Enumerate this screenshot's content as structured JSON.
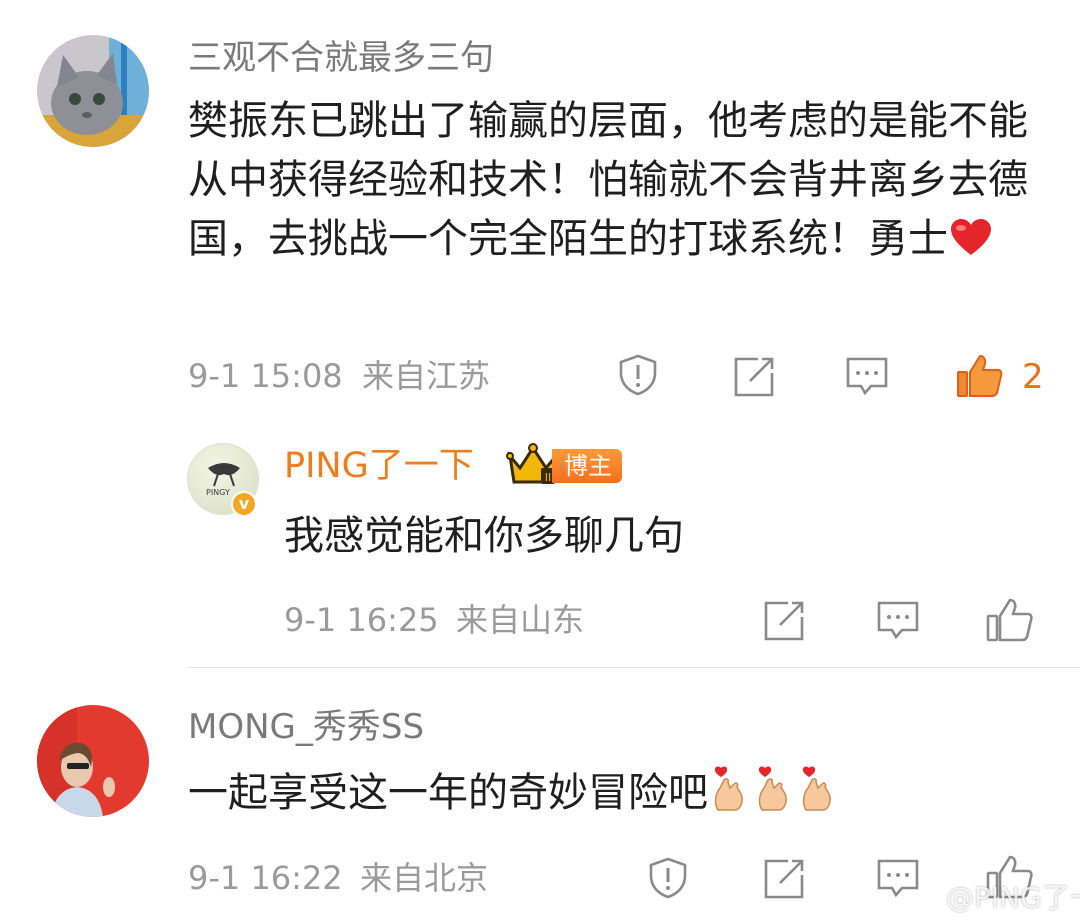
{
  "comments": [
    {
      "username": "三观不合就最多三句",
      "text": "樊振东已跳出了输赢的层面，他考虑的是能不能从中获得经验和技术！怕输就不会背井离乡去德国，去挑战一个完全陌生的打球系统！勇士",
      "emoji": "heart-emoji",
      "time": "9-1 15:08",
      "location": "来自江苏",
      "likes": "2"
    },
    {
      "username": "PING了一下",
      "badge": "博主",
      "avatar_text": "PINGY",
      "text": "我感觉能和你多聊几句",
      "time": "9-1 16:25",
      "location": "来自山东"
    },
    {
      "username": "MONG_秀秀SS",
      "text": "一起享受这一年的奇妙冒险吧",
      "emoji": "finger-heart-emoji",
      "time": "9-1 16:22",
      "location": "来自北京"
    }
  ],
  "watermark": "@PING了一下",
  "colors": {
    "accent": "#ef7d1d",
    "meta": "#9a9a9a"
  }
}
